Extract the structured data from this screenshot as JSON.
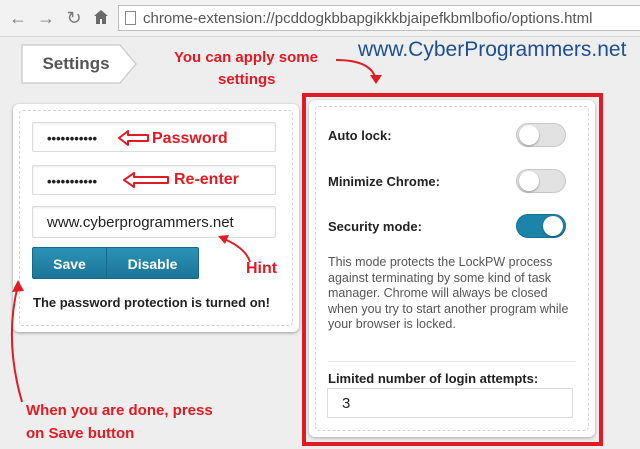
{
  "browser": {
    "url": "chrome-extension://pcddogkbbapgikkkbjaipefkbmlbofio/options.html"
  },
  "tab": {
    "label": "Settings"
  },
  "left_card": {
    "password_value": "•••••••••••",
    "reenter_value": "•••••••••••",
    "hint_value": "www.cyberprogrammers.net",
    "save_label": "Save",
    "disable_label": "Disable",
    "status_text": "The password protection is turned on!"
  },
  "right_card": {
    "auto_lock_label": "Auto lock:",
    "auto_lock_on": false,
    "minimize_label": "Minimize Chrome:",
    "minimize_on": false,
    "security_label": "Security mode:",
    "security_on": true,
    "security_desc": "This mode protects the LockPW process against terminating by some kind of task manager. Chrome will always be closed when you try to start another program while your browser is locked.",
    "limit_label": "Limited number of login attempts:",
    "limit_value": "3"
  },
  "annotations": {
    "password": "Password",
    "reenter": "Re-enter",
    "hint": "Hint",
    "apply_line1": "You can apply some",
    "apply_line2": "settings",
    "done_line1": "When you are done, press",
    "done_line2": "on Save button",
    "watermark": "www.CyberProgrammers.net"
  },
  "colors": {
    "accent": "#1b84a8",
    "annotation_red": "#e01b24",
    "watermark_blue": "#1e4f8f"
  },
  "icons": [
    "back-arrow-icon",
    "forward-arrow-icon",
    "reload-icon",
    "home-icon",
    "page-icon"
  ]
}
